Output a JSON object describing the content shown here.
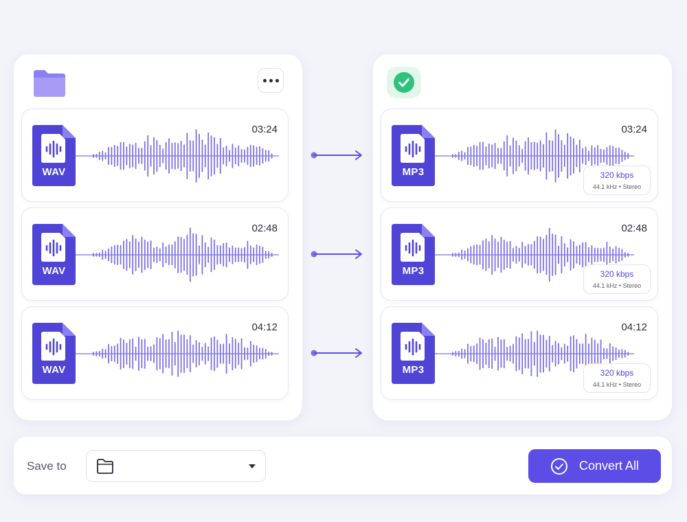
{
  "source": {
    "folder_icon": "folder-icon",
    "menu_icon": "more-horizontal-icon",
    "files": [
      {
        "ext": "WAV",
        "duration": "03:24"
      },
      {
        "ext": "WAV",
        "duration": "02:48"
      },
      {
        "ext": "WAV",
        "duration": "04:12"
      }
    ]
  },
  "output": {
    "status_icon": "check-circle-icon",
    "files": [
      {
        "ext": "MP3",
        "duration": "03:24",
        "bitrate": "320 kbps",
        "format_info": "44.1 kHz • Stereo"
      },
      {
        "ext": "MP3",
        "duration": "02:48",
        "bitrate": "320 kbps",
        "format_info": "44.1 kHz • Stereo"
      },
      {
        "ext": "MP3",
        "duration": "04:12",
        "bitrate": "320 kbps",
        "format_info": "44.1 kHz • Stereo"
      }
    ]
  },
  "bottom_bar": {
    "save_label": "Save to",
    "save_select_value": "",
    "convert_label": "Convert All"
  },
  "colors": {
    "accent": "#5b4de6",
    "file_icon": "#4f44d6",
    "waveform": "#7c70e6",
    "success": "#2ec27e",
    "background": "#f3f3fa"
  }
}
